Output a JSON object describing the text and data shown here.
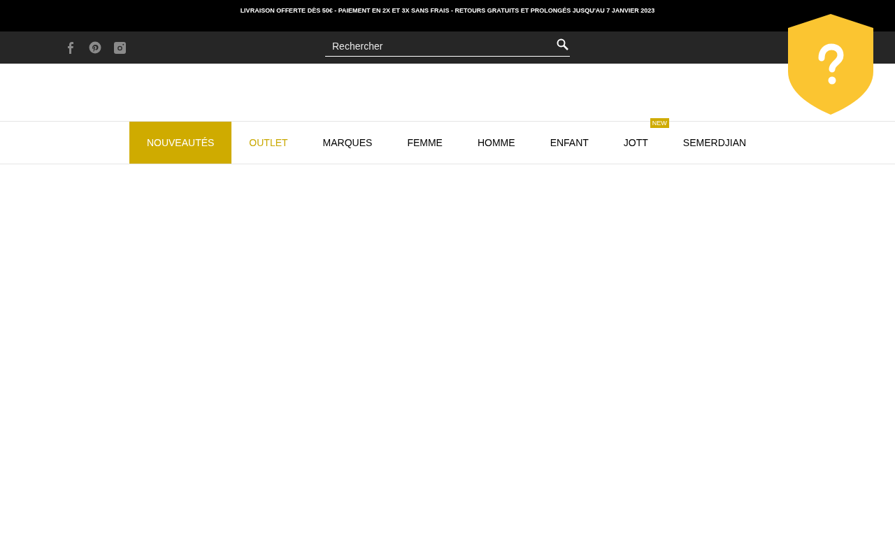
{
  "announcement_bar": {
    "text": "LIVRAISON OFFERTE DÈS 50€ - PAIEMENT EN 2X ET 3X SANS FRAIS - RETOURS GRATUITS ET PROLONGÉS JUSQU'AU 7 JANVIER 2023"
  },
  "search": {
    "placeholder": "Rechercher"
  },
  "nav": [
    {
      "label": "NOUVEAUTÉS",
      "selected": true,
      "kind": "normal"
    },
    {
      "label": "OUTLET",
      "selected": false,
      "kind": "accent"
    },
    {
      "label": "MARQUES",
      "selected": false,
      "kind": "normal"
    },
    {
      "label": "FEMME",
      "selected": false,
      "kind": "normal"
    },
    {
      "label": "HOMME",
      "selected": false,
      "kind": "normal"
    },
    {
      "label": "ENFANT",
      "selected": false,
      "kind": "normal"
    },
    {
      "label": "JOTT",
      "selected": false,
      "kind": "normal",
      "badge": "NEW"
    },
    {
      "label": "SEMERDJIAN",
      "selected": false,
      "kind": "normal"
    }
  ]
}
